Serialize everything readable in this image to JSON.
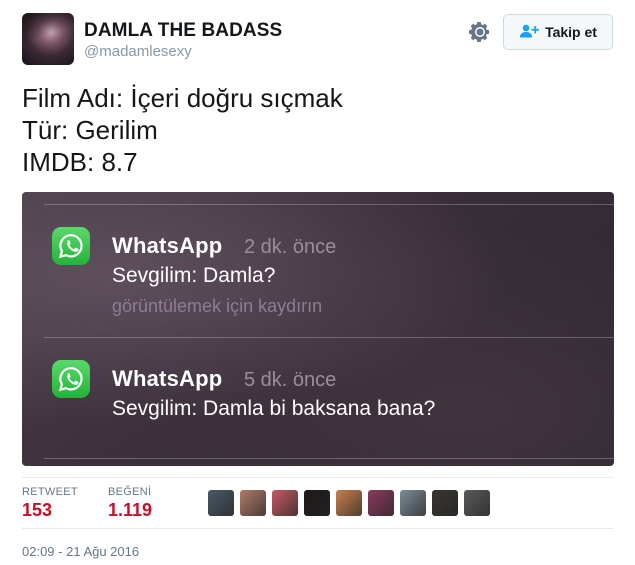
{
  "header": {
    "display_name": "DAMLA THE BADASS",
    "handle": "@madamlesexy",
    "follow_label": "Takip et"
  },
  "tweet": {
    "lines": [
      "Film Adı: İçeri doğru sıçmak",
      "Tür: Gerilim",
      "IMDB: 8.7"
    ]
  },
  "media": {
    "notifications": [
      {
        "app": "WhatsApp",
        "time": "2 dk. önce",
        "message": "Sevgilim: Damla?",
        "hint": "görüntülemek için kaydırın"
      },
      {
        "app": "WhatsApp",
        "time": "5 dk. önce",
        "message": "Sevgilim: Damla bi baksana bana?"
      }
    ]
  },
  "stats": {
    "retweet_label": "RETWEET",
    "retweet_count": "153",
    "like_label": "BEĞENİ",
    "like_count": "1.119"
  },
  "likers": [
    {
      "name": "liker-avatar-1",
      "color": "#4a5a66"
    },
    {
      "name": "liker-avatar-2",
      "color": "#b07a6a"
    },
    {
      "name": "liker-avatar-3",
      "color": "#c25b63"
    },
    {
      "name": "liker-avatar-4",
      "color": "#1f1a1a"
    },
    {
      "name": "liker-avatar-5",
      "color": "#c7804d"
    },
    {
      "name": "liker-avatar-6",
      "color": "#8a3b5e"
    },
    {
      "name": "liker-avatar-7",
      "color": "#7d8b95"
    },
    {
      "name": "liker-avatar-8",
      "color": "#3a3530"
    },
    {
      "name": "liker-avatar-9",
      "color": "#5a5a5a"
    }
  ],
  "footer": {
    "timestamp": "02:09 - 21 Ağu 2016"
  },
  "colors": {
    "accent_red": "#c3112b",
    "whatsapp_green": "#25b33d"
  },
  "icons": {
    "settings": "gear-icon",
    "follow": "add-person-icon",
    "notification": "whatsapp-icon"
  }
}
